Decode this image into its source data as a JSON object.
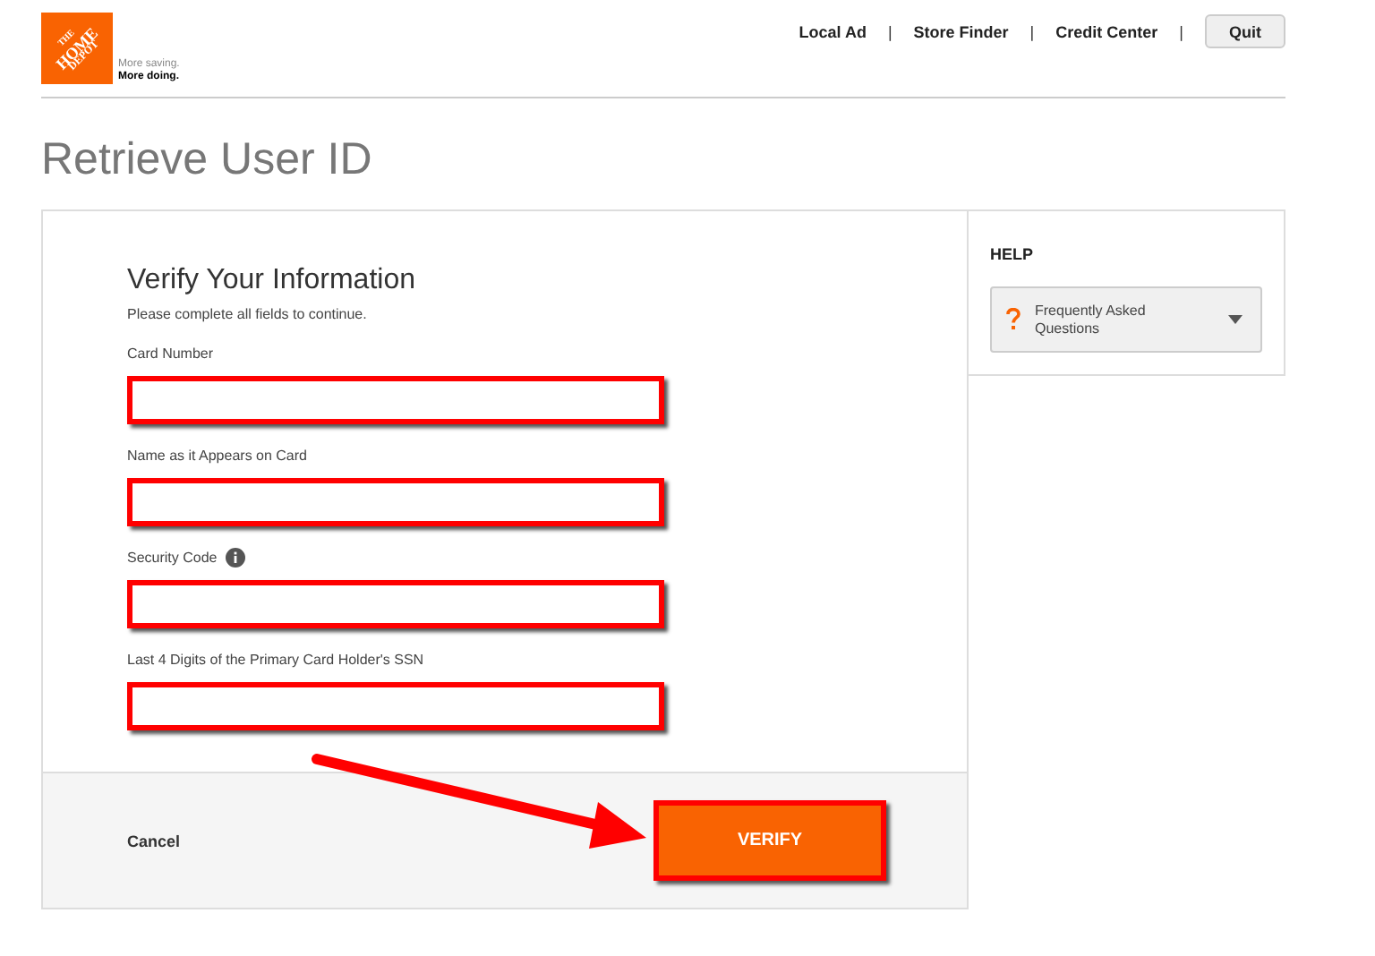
{
  "logo": {
    "lines": [
      "THE",
      "HOME",
      "DEPOT"
    ],
    "tagline": [
      "More saving.",
      "More doing."
    ]
  },
  "nav": {
    "links": [
      {
        "label": "Local Ad",
        "separator": "|"
      },
      {
        "label": "Store Finder",
        "separator": "|"
      },
      {
        "label": "Credit Center",
        "separator": "|"
      }
    ],
    "quit": "Quit"
  },
  "page_title": "Retrieve User ID",
  "form": {
    "heading": "Verify Your Information",
    "instructions": "Please complete all fields to continue.",
    "fields": [
      {
        "label": "Card Number",
        "info_icon": false,
        "highlighted": true
      },
      {
        "label": "Name as it Appears on Card",
        "info_icon": false,
        "highlighted": true
      },
      {
        "label": "Security Code",
        "info_icon": true,
        "highlighted": true
      },
      {
        "label": "Last 4 Digits of the Primary Card Holder's SSN",
        "info_icon": false,
        "highlighted": true
      }
    ],
    "cancel": "Cancel",
    "submit": "VERIFY",
    "submit_highlighted": true,
    "annotation_arrow": true
  },
  "help": {
    "title": "HELP",
    "items": [
      {
        "label": "Frequently Asked Questions",
        "expanded": false
      }
    ]
  }
}
